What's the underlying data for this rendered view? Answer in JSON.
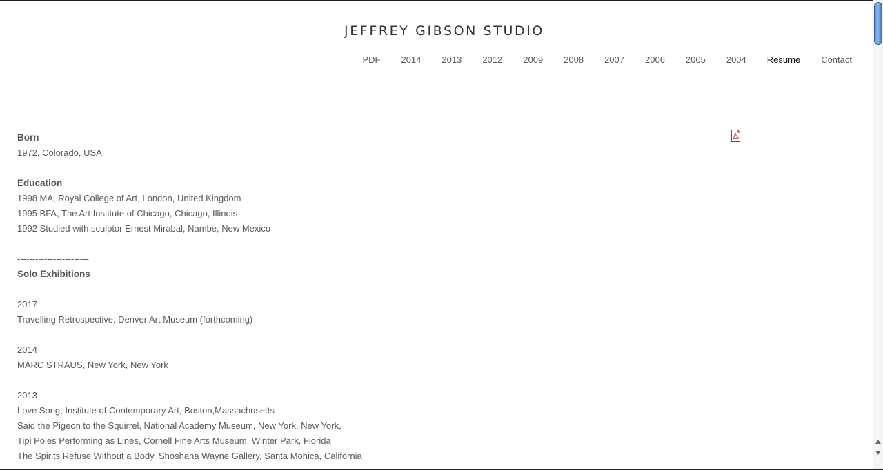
{
  "site": {
    "title": "JEFFREY GIBSON STUDIO"
  },
  "nav": {
    "items": [
      {
        "label": "PDF"
      },
      {
        "label": "2014"
      },
      {
        "label": "2013"
      },
      {
        "label": "2012"
      },
      {
        "label": "2009"
      },
      {
        "label": "2008"
      },
      {
        "label": "2007"
      },
      {
        "label": "2006"
      },
      {
        "label": "2005"
      },
      {
        "label": "2004"
      },
      {
        "label": "Resume"
      },
      {
        "label": "Contact"
      }
    ],
    "active": "Resume"
  },
  "icons": {
    "pdf": "pdf-icon"
  },
  "resume": {
    "born_heading": "Born",
    "born_text": "1972, Colorado, USA",
    "education_heading": "Education",
    "education": [
      "1998 MA, Royal College of Art, London, United Kingdom",
      "1995 BFA, The Art Institute of Chicago, Chicago, Illinois",
      "1992 Studied with sculptor Ernest Mirabal, Nambe, New Mexico"
    ],
    "divider": "------------------------",
    "solo_heading": "Solo Exhibitions",
    "solo": [
      {
        "year": "2017",
        "items": [
          "Travelling Retrospective, Denver Art Museum (forthcoming)"
        ]
      },
      {
        "year": "2014",
        "items": [
          "MARC STRAUS, New York, New York"
        ]
      },
      {
        "year": "2013",
        "items": [
          "Love Song, Institute of Contemporary Art, Boston,Massachusetts",
          "Said the Pigeon to the Squirrel, National Academy Museum, New York, New York,",
          "Tipi Poles Performing as Lines, Cornell Fine Arts Museum, Winter Park, Florida",
          "The Spirits Refuse Without a Body, Shoshana Wayne Gallery, Santa Monica, California"
        ]
      }
    ]
  }
}
